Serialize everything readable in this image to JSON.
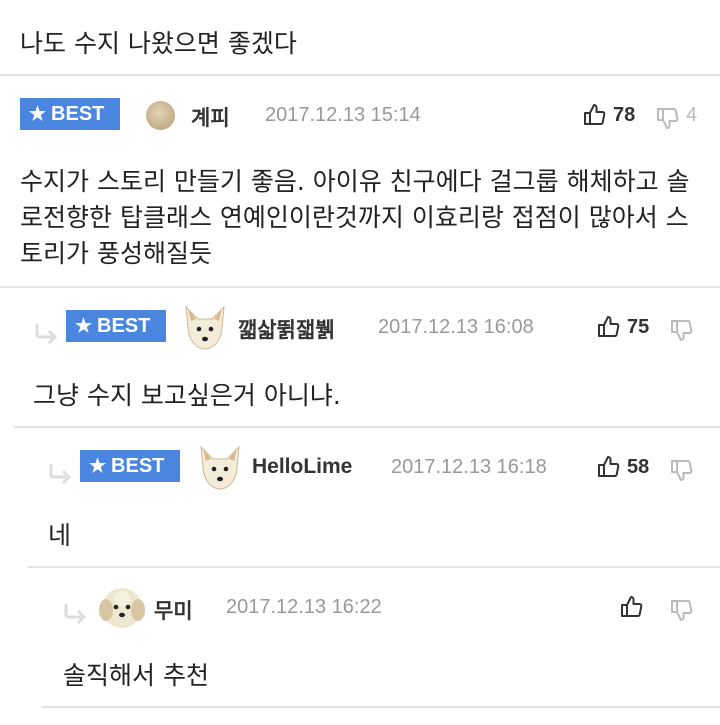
{
  "top_comment": {
    "text": "나도 수지 나왔으면 좋겠다"
  },
  "comments": [
    {
      "best_label": "BEST",
      "nickname": "계피",
      "date": "2017.12.13 15:14",
      "likes": "78",
      "dislikes": "4",
      "text": "수지가 스토리 만들기 좋음. 아이유 친구에다 걸그룹 해체하고 솔로전향한 탑클래스 연예인이란것까지 이효리랑 접점이 많아서 스토리가 풍성해질듯"
    },
    {
      "best_label": "BEST",
      "nickname": "깳삷뛹잷뷁",
      "date": "2017.12.13 16:08",
      "likes": "75",
      "text": "그냥 수지 보고싶은거 아니냐."
    },
    {
      "best_label": "BEST",
      "nickname": "HelloLime",
      "date": "2017.12.13 16:18",
      "likes": "58",
      "text": "네"
    },
    {
      "nickname": "무미",
      "date": "2017.12.13 16:22",
      "text": "솔직해서 추천"
    }
  ],
  "colors": {
    "best_badge": "#4a86e0",
    "date": "#999999",
    "divider": "#e4e4e4"
  },
  "icons": [
    "thumbs-up-icon",
    "thumbs-down-icon",
    "reply-arrow-icon",
    "star-icon"
  ]
}
